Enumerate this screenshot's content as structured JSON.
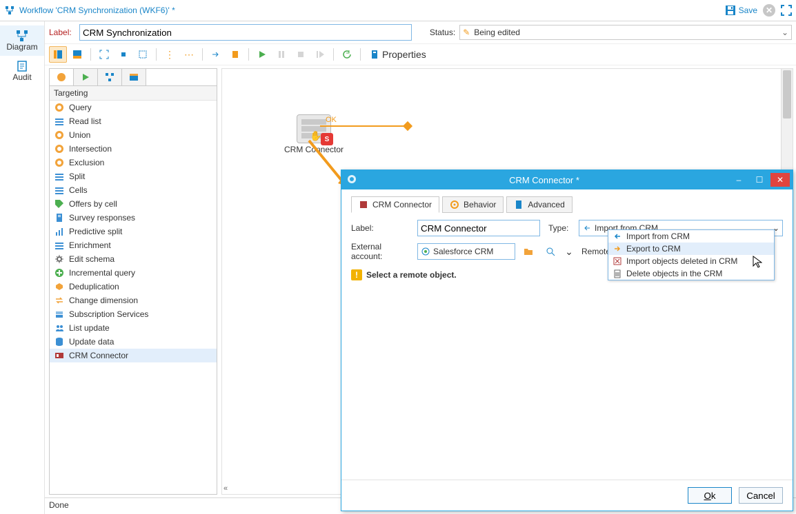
{
  "titlebar": {
    "title": "Workflow 'CRM Synchronization (WKF6)' *",
    "save": "Save"
  },
  "sidebar": {
    "items": [
      {
        "label": "Diagram"
      },
      {
        "label": "Audit"
      }
    ]
  },
  "header": {
    "label_caption": "Label:",
    "label_value": "CRM Synchronization",
    "status_caption": "Status:",
    "status_value": "Being edited"
  },
  "toolbar": {
    "properties": "Properties"
  },
  "palette": {
    "group": "Targeting",
    "items": [
      "Query",
      "Read list",
      "Union",
      "Intersection",
      "Exclusion",
      "Split",
      "Cells",
      "Offers by cell",
      "Survey responses",
      "Predictive split",
      "Enrichment",
      "Edit schema",
      "Incremental query",
      "Deduplication",
      "Change dimension",
      "Subscription Services",
      "List update",
      "Update data",
      "CRM Connector"
    ],
    "selected_index": 18
  },
  "palette_icons": [
    {
      "shape": "circle",
      "color": "#f2a33a"
    },
    {
      "shape": "bars",
      "color": "#3b8fd4"
    },
    {
      "shape": "circle",
      "color": "#f2a33a"
    },
    {
      "shape": "circle",
      "color": "#f2a33a"
    },
    {
      "shape": "circle",
      "color": "#f2a33a"
    },
    {
      "shape": "bars",
      "color": "#3b8fd4"
    },
    {
      "shape": "bars",
      "color": "#3b8fd4"
    },
    {
      "shape": "tag",
      "color": "#4caf50"
    },
    {
      "shape": "doc",
      "color": "#3b8fd4"
    },
    {
      "shape": "chart",
      "color": "#3b8fd4"
    },
    {
      "shape": "bars",
      "color": "#3b8fd4"
    },
    {
      "shape": "gear",
      "color": "#6a6a6a"
    },
    {
      "shape": "plus",
      "color": "#4caf50"
    },
    {
      "shape": "dedup",
      "color": "#f2a33a"
    },
    {
      "shape": "swap",
      "color": "#f2a33a"
    },
    {
      "shape": "stack",
      "color": "#3b8fd4"
    },
    {
      "shape": "people",
      "color": "#3b8fd4"
    },
    {
      "shape": "db",
      "color": "#3b8fd4"
    },
    {
      "shape": "crm",
      "color": "#b03a3a"
    }
  ],
  "canvas": {
    "node_label": "CRM Connector",
    "edge_label": "OK"
  },
  "statusbar": "Done",
  "dialog": {
    "title": "CRM Connector *",
    "tabs": [
      {
        "label": "CRM Connector"
      },
      {
        "label": "Behavior"
      },
      {
        "label": "Advanced"
      }
    ],
    "label_caption": "Label:",
    "label_value": "CRM Connector",
    "type_caption": "Type:",
    "type_value": "Import from CRM",
    "extacct_caption": "External account:",
    "extacct_value": "Salesforce CRM",
    "remote_caption": "Remote object:",
    "warning": "Select a remote object.",
    "type_options": [
      "Import from CRM",
      "Export to CRM",
      "Import objects deleted in CRM",
      "Delete objects in the CRM"
    ],
    "hover_index": 1,
    "ok": "Ok",
    "cancel": "Cancel"
  }
}
